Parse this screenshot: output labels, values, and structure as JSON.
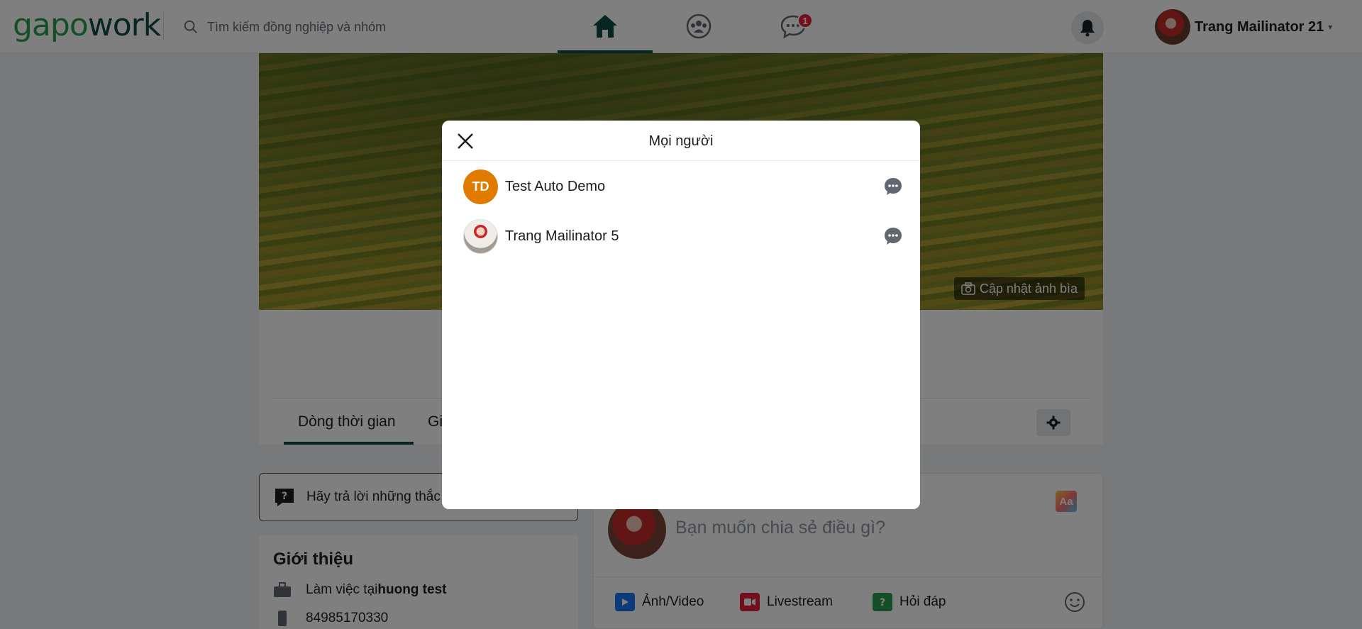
{
  "header": {
    "logo_part1": "gapo",
    "logo_part2": "work",
    "search_placeholder": "Tìm kiếm đồng nghiệp và nhóm",
    "chat_badge": "1",
    "profile_name": "Trang Mailinator 21",
    "caret": "▾"
  },
  "cover": {
    "update_button": "Cập nhật ảnh bìa"
  },
  "profile": {
    "tabs": [
      {
        "label": "Dòng thời gian"
      },
      {
        "label": "Gi"
      }
    ]
  },
  "qa_prompt": "Hãy trả lời những thắc",
  "intro": {
    "title": "Giới thiệu",
    "work_prefix": "Làm việc tại ",
    "work_place": "huong test",
    "phone": "84985170330"
  },
  "composer": {
    "placeholder": "Bạn muốn chia sẻ điều gì?",
    "aa_label": "Aa",
    "actions": [
      {
        "label": "Ảnh/Video",
        "color": "#1877f2"
      },
      {
        "label": "Livestream",
        "color": "#e41e3f"
      },
      {
        "label": "Hỏi đáp",
        "color": "#2b9f4f"
      }
    ]
  },
  "modal": {
    "title": "Mọi người",
    "members": [
      {
        "name": "Test Auto Demo",
        "initials": "TD"
      },
      {
        "name": "Trang Mailinator 5",
        "initials": ""
      }
    ]
  },
  "colors": {
    "brand_green": "#2b9f4f",
    "brand_dark": "#0e4d46",
    "initials_orange": "#e07b00",
    "badge_red": "#e41e3f"
  }
}
